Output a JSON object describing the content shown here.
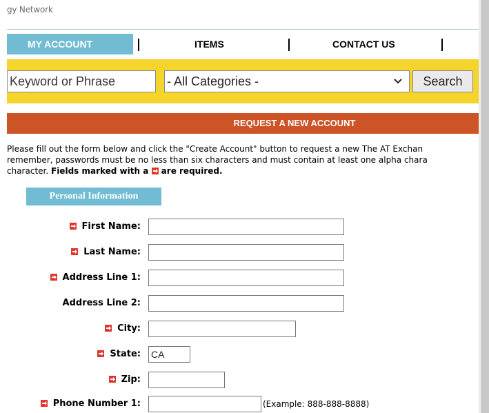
{
  "brand": "gy Network",
  "nav": {
    "my_account": "MY ACCOUNT",
    "items": "ITEMS",
    "contact": "CONTACT US"
  },
  "search": {
    "keyword_placeholder": "Keyword or Phrase",
    "category_selected": "- All Categories -",
    "button": "Search"
  },
  "banner": "REQUEST A NEW ACCOUNT",
  "intro": {
    "line1": "Please fill out the form below and click the \"Create Account\" button to request a new The AT Exchan",
    "line2": "remember, passwords must be no less than six characters and must contain at least one alpha chara",
    "line3_start": "character. ",
    "line3_bold_a": "Fields marked with a ",
    "line3_bold_b": " are required."
  },
  "section": "Personal Information",
  "form": {
    "first_name": "First Name:",
    "last_name": "Last Name:",
    "address1": "Address Line 1:",
    "address2": "Address Line 2:",
    "city": "City:",
    "state": "State:",
    "state_value": "CA",
    "zip": "Zip:",
    "phone1": "Phone Number 1:",
    "phone_hint": "(Example: 888-888-8888)"
  },
  "colors": {
    "accent_blue": "#72bcd3",
    "search_yellow": "#f5d42c",
    "banner_orange": "#cc5427",
    "required_red": "#e0342d"
  },
  "icons": {
    "required": "required-marker-icon",
    "dropdown": "chevron-down-icon"
  }
}
